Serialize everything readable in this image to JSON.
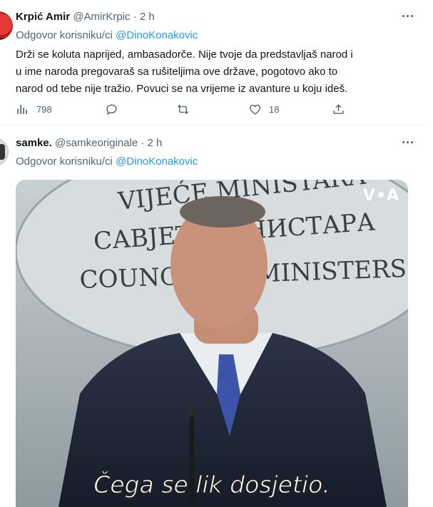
{
  "tweets": [
    {
      "name": "Krpić Amir",
      "handle": "@AmirKrpic",
      "dot": "·",
      "time": "2 h",
      "reply_prefix": "Odgovor korisniku/ci",
      "reply_mention": "@DinoKonakovic",
      "text": "Drži se koluta naprijed, ambasadorče. Nije tvoje da predstavljaš narod i u ime naroda pregovaraš sa rušiteljima ove države, pogotovo ako to narod od tebe nije tražio. Povuci se na vrijeme iz avanture u koju ideš.",
      "actions": {
        "views_icon": "bar-chart-icon",
        "views": "798",
        "reply_icon": "comment-icon",
        "retweet_icon": "retweet-icon",
        "like_icon": "heart-icon",
        "likes": "18",
        "share_icon": "share-icon"
      }
    },
    {
      "name": "samke.",
      "handle": "@samkeoriginale",
      "dot": "·",
      "time": "2 h",
      "reply_prefix": "Odgovor korisniku/ci",
      "reply_mention": "@DinoKonakovic",
      "media": {
        "backdrop_line1": "VIJEĆE MINISTARA",
        "backdrop_line2": "САВЈЕТ МИНИСТАРА",
        "backdrop_line3": "COUNCIL OF MINISTERS",
        "watermark": "V•A",
        "caption": "Čega se lik dosjetio."
      }
    }
  ],
  "colors": {
    "accent": "#1d9bf0",
    "muted": "#536471",
    "text": "#0f1419"
  }
}
